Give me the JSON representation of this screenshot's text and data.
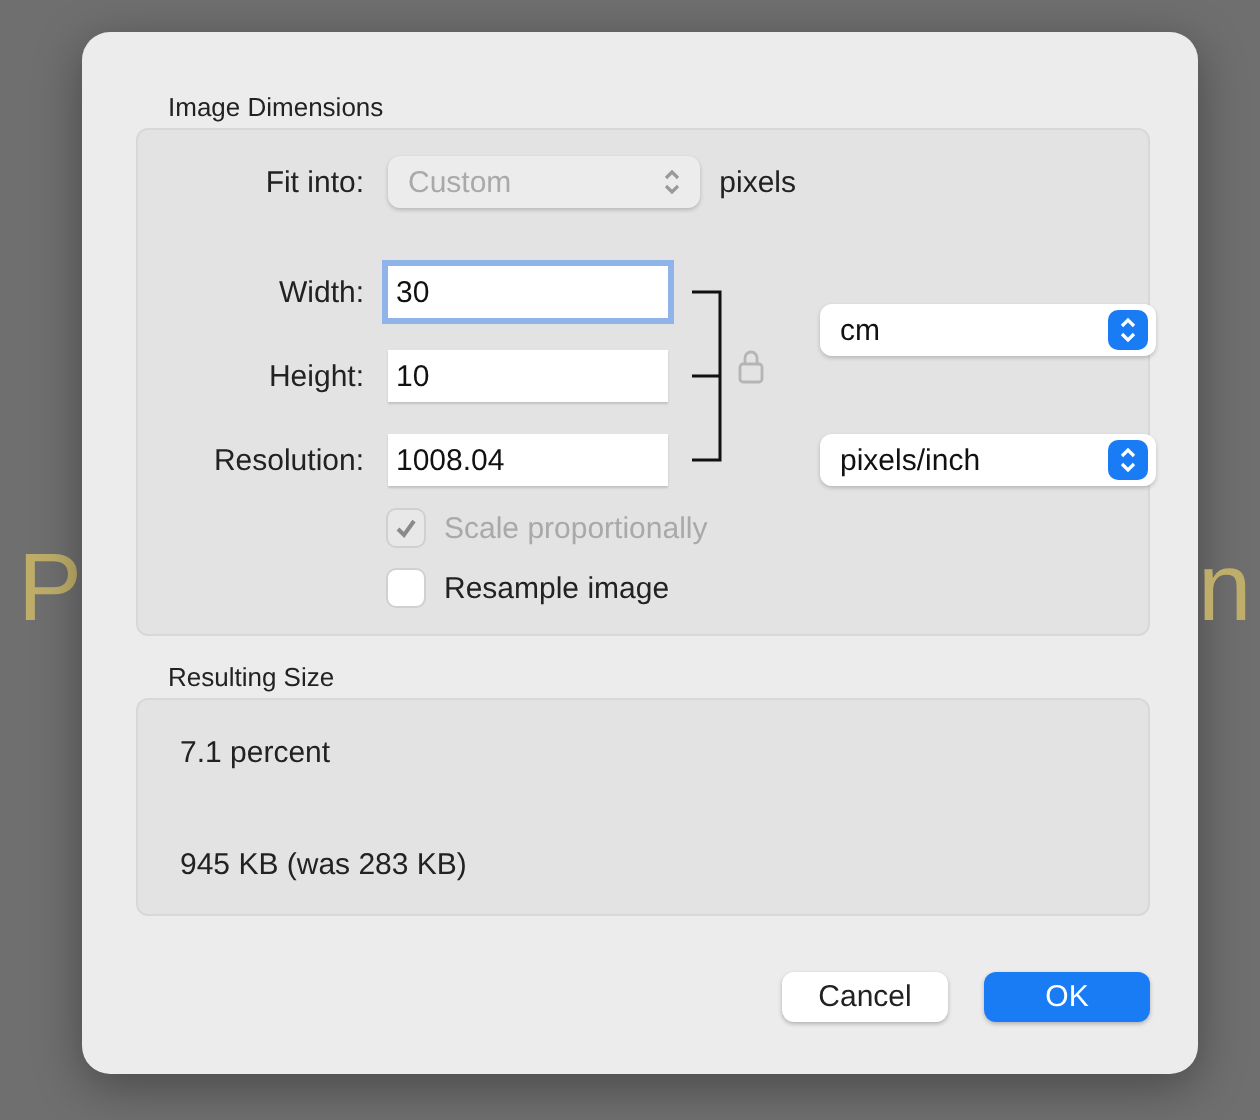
{
  "backdrop": {
    "left_text": "P",
    "right_text": "n"
  },
  "dimensions": {
    "title": "Image Dimensions",
    "fit_into": {
      "label": "Fit into:",
      "value": "Custom",
      "disabled": true,
      "unit": "pixels"
    },
    "fields": [
      {
        "label": "Width:",
        "value": "30",
        "focused": true
      },
      {
        "label": "Height:",
        "value": "10",
        "focused": false
      },
      {
        "label": "Resolution:",
        "value": "1008.04",
        "focused": false
      }
    ],
    "linked": true,
    "size_unit": "cm",
    "resolution_unit": "pixels/inch",
    "options": [
      {
        "label": "Scale proportionally",
        "checked": true,
        "disabled": true
      },
      {
        "label": "Resample image",
        "checked": false,
        "disabled": false
      }
    ]
  },
  "result": {
    "title": "Resulting Size",
    "percent": "7.1 percent",
    "size": "945 KB (was 283 KB)"
  },
  "buttons": [
    {
      "label": "Cancel",
      "kind": "secondary"
    },
    {
      "label": "OK",
      "kind": "primary"
    }
  ]
}
